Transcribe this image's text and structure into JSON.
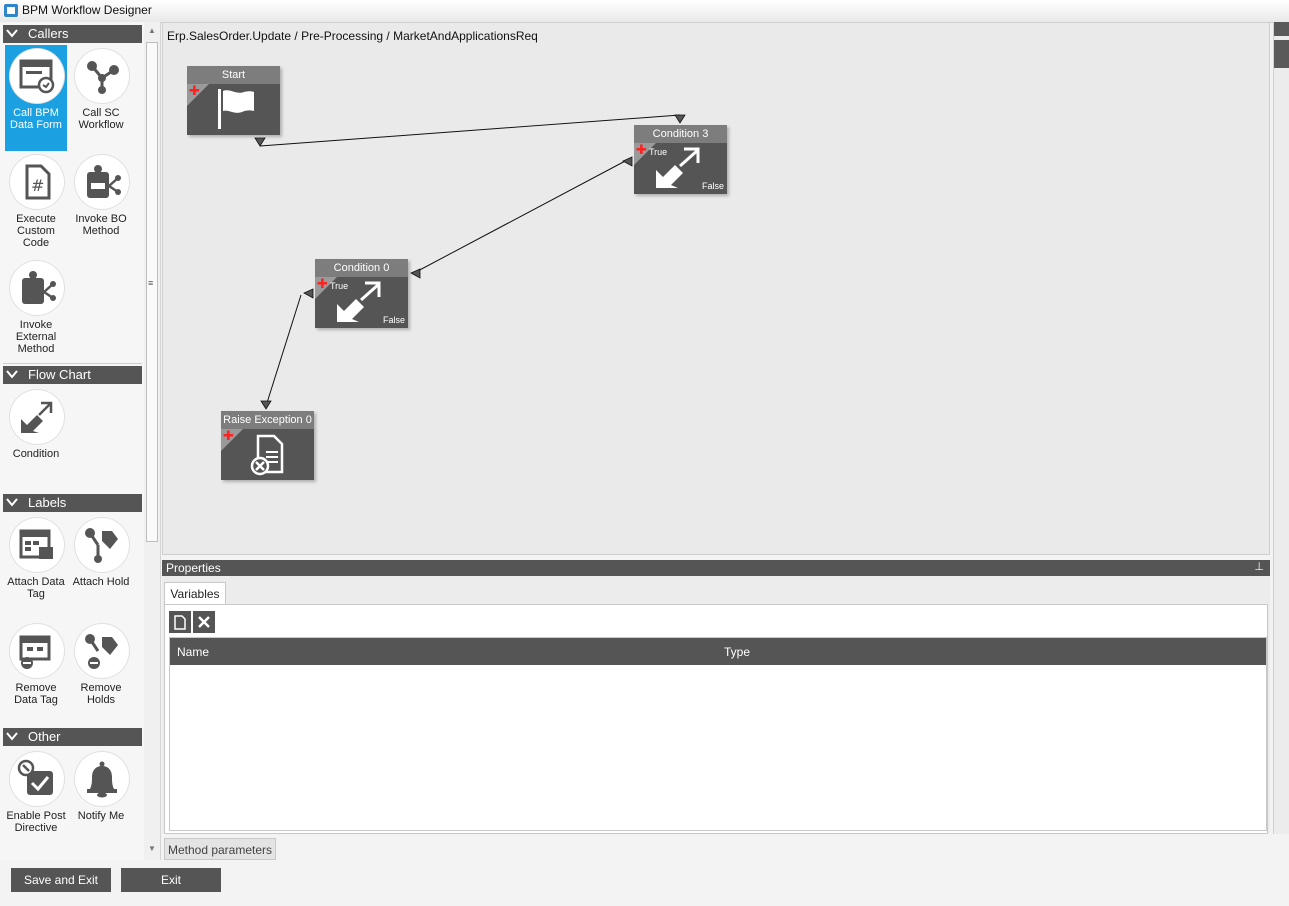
{
  "window": {
    "title": "BPM Workflow Designer"
  },
  "toolbox": {
    "categories": [
      {
        "label": "Callers"
      },
      {
        "label": "Flow Chart"
      },
      {
        "label": "Labels"
      },
      {
        "label": "Other"
      }
    ],
    "callers": [
      {
        "label": "Call BPM Data Form",
        "icon": "data-form-icon",
        "selected": true
      },
      {
        "label": "Call SC Workflow",
        "icon": "workflow-nodes-icon"
      },
      {
        "label": "Execute Custom Code",
        "icon": "code-file-icon"
      },
      {
        "label": "Invoke BO Method",
        "icon": "bo-method-icon"
      },
      {
        "label": "Invoke External Method",
        "icon": "external-method-icon"
      }
    ],
    "flow_chart": [
      {
        "label": "Condition",
        "icon": "condition-arrows-icon"
      }
    ],
    "labels": [
      {
        "label": "Attach Data Tag",
        "icon": "data-tag-icon"
      },
      {
        "label": "Attach Hold",
        "icon": "hold-tag-icon"
      },
      {
        "label": "Remove Data Tag",
        "icon": "remove-data-tag-icon"
      },
      {
        "label": "Remove Holds",
        "icon": "remove-holds-icon"
      }
    ],
    "other": [
      {
        "label": "Enable Post Directive",
        "icon": "post-directive-icon"
      },
      {
        "label": "Notify Me",
        "icon": "bell-icon"
      }
    ]
  },
  "canvas": {
    "breadcrumb": "Erp.SalesOrder.Update / Pre-Processing / MarketAndApplicationsReq",
    "nodes": {
      "start": {
        "title": "Start"
      },
      "condition3": {
        "title": "Condition 3",
        "true_label": "True",
        "false_label": "False"
      },
      "condition0": {
        "title": "Condition 0",
        "true_label": "True",
        "false_label": "False"
      },
      "raise_exception": {
        "title": "Raise Exception 0"
      }
    }
  },
  "properties": {
    "title": "Properties",
    "tab_variables": "Variables",
    "columns": {
      "name": "Name",
      "type": "Type"
    },
    "method_parameters_tab": "Method parameters"
  },
  "footer": {
    "save_exit": "Save and Exit",
    "exit": "Exit"
  },
  "colors": {
    "accent": "#1ba1e2",
    "dark": "#555555",
    "plus": "#ff2020"
  }
}
